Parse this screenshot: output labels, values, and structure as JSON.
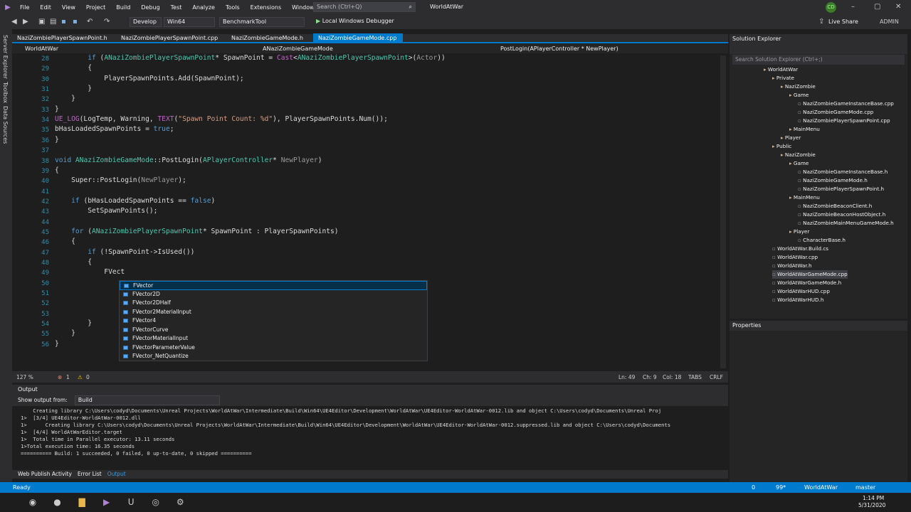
{
  "menu": [
    "File",
    "Edit",
    "View",
    "Project",
    "Build",
    "Debug",
    "Test",
    "Analyze",
    "Tools",
    "Extensions",
    "Window",
    "Help"
  ],
  "search_placeholder": "Search (Ctrl+Q)",
  "window_title": "WorldAtWar",
  "user_initials": "CD",
  "live_share": "Live Share",
  "admin": "ADMIN",
  "toolbar": {
    "config": "Develop",
    "platform": "Win64",
    "startup": "BenchmarkTool",
    "debugger": "Local Windows Debugger"
  },
  "side_tabs": [
    "Server Explorer",
    "Toolbox",
    "Data Sources"
  ],
  "tabs": [
    {
      "label": "NaziZombiePlayerSpawnPoint.h",
      "active": false
    },
    {
      "label": "NaziZombiePlayerSpawnPoint.cpp",
      "active": false
    },
    {
      "label": "NaziZombieGameMode.h",
      "active": false
    },
    {
      "label": "NaziZombieGameMode.cpp",
      "active": true
    }
  ],
  "nav": {
    "project": "WorldAtWar",
    "class": "ANaziZombieGameMode",
    "member": "PostLogin(APlayerController * NewPlayer)"
  },
  "line_numbers": [
    "28",
    "29",
    "30",
    "31",
    "32",
    "33",
    "34",
    "35",
    "36",
    "37",
    "38",
    "39",
    "40",
    "41",
    "42",
    "43",
    "44",
    "45",
    "46",
    "47",
    "48",
    "49",
    "50",
    "51",
    "52",
    "53",
    "54",
    "55",
    "56"
  ],
  "code_lines": [
    "        if (ANaziZombiePlayerSpawnPoint* SpawnPoint = Cast<ANaziZombiePlayerSpawnPoint>(Actor))",
    "        {",
    "            PlayerSpawnPoints.Add(SpawnPoint);",
    "        }",
    "    }",
    "}",
    "UE_LOG(LogTemp, Warning, TEXT(\"Spawn Point Count: %d\"), PlayerSpawnPoints.Num());",
    "bHasLoadedSpawnPoints = true;",
    "}",
    "",
    "void ANaziZombieGameMode::PostLogin(APlayerController* NewPlayer)",
    "{",
    "    Super::PostLogin(NewPlayer);",
    "",
    "    if (bHasLoadedSpawnPoints == false)",
    "        SetSpawnPoints();",
    "",
    "    for (ANaziZombiePlayerSpawnPoint* SpawnPoint : PlayerSpawnPoints)",
    "    {",
    "        if (!SpawnPoint->IsUsed())",
    "        {",
    "            FVect",
    "",
    "",
    "",
    "",
    "        }",
    "    }",
    "}"
  ],
  "autocomplete": [
    "FVector",
    "FVector2D",
    "FVector2DHalf",
    "FVector2MaterialInput",
    "FVector4",
    "FVectorCurve",
    "FVectorMaterialInput",
    "FVectorParameterValue",
    "FVector_NetQuantize"
  ],
  "editor_status": {
    "zoom": "127 %",
    "errors": "1",
    "warnings": "0",
    "ln": "Ln: 49",
    "ch": "Ch: 9",
    "col": "Col: 18",
    "tabs": "TABS",
    "crlf": "CRLF"
  },
  "output": {
    "title": "Output",
    "show_from_label": "Show output from:",
    "show_from_value": "Build",
    "lines": [
      "    Creating library C:\\Users\\codyd\\Documents\\Unreal Projects\\WorldAtWar\\Intermediate\\Build\\Win64\\UE4Editor\\Development\\WorldAtWar\\UE4Editor-WorldAtWar-0012.lib and object C:\\Users\\codyd\\Documents\\Unreal Proj",
      "1>  [3/4] UE4Editor-WorldAtWar-0012.dll",
      "1>      Creating library C:\\Users\\codyd\\Documents\\Unreal Projects\\WorldAtWar\\Intermediate\\Build\\Win64\\UE4Editor\\Development\\WorldAtWar\\UE4Editor-WorldAtWar-0012.suppressed.lib and object C:\\Users\\codyd\\Documents",
      "1>  [4/4] WorldAtWarEditor.target",
      "1>  Total time in Parallel executor: 13.11 seconds",
      "1>Total execution time: 16.35 seconds",
      "========== Build: 1 succeeded, 0 failed, 0 up-to-date, 0 skipped =========="
    ]
  },
  "bottom_tabs": [
    "Web Publish Activity",
    "Error List",
    "Output"
  ],
  "solution_explorer": {
    "title": "Solution Explorer",
    "search": "Search Solution Explorer (Ctrl+;)",
    "items": [
      {
        "label": "WorldAtWar",
        "depth": 0
      },
      {
        "label": "Private",
        "depth": 1
      },
      {
        "label": "NaziZombie",
        "depth": 2
      },
      {
        "label": "Game",
        "depth": 3
      },
      {
        "label": "NaziZombieGameInstanceBase.cpp",
        "depth": 4
      },
      {
        "label": "NaziZombieGameMode.cpp",
        "depth": 4
      },
      {
        "label": "NaziZombiePlayerSpawnPoint.cpp",
        "depth": 4
      },
      {
        "label": "MainMenu",
        "depth": 3
      },
      {
        "label": "Player",
        "depth": 2
      },
      {
        "label": "Public",
        "depth": 1
      },
      {
        "label": "NaziZombie",
        "depth": 2
      },
      {
        "label": "Game",
        "depth": 3
      },
      {
        "label": "NaziZombieGameInstanceBase.h",
        "depth": 4
      },
      {
        "label": "NaziZombieGameMode.h",
        "depth": 4
      },
      {
        "label": "NaziZombiePlayerSpawnPoint.h",
        "depth": 4
      },
      {
        "label": "MainMenu",
        "depth": 3
      },
      {
        "label": "NaziZombieBeaconClient.h",
        "depth": 4
      },
      {
        "label": "NaziZombieBeaconHostObject.h",
        "depth": 4
      },
      {
        "label": "NaziZombieMainMenuGameMode.h",
        "depth": 4
      },
      {
        "label": "Player",
        "depth": 3
      },
      {
        "label": "CharacterBase.h",
        "depth": 4
      },
      {
        "label": "WorldAtWar.Build.cs",
        "depth": 1
      },
      {
        "label": "WorldAtWar.cpp",
        "depth": 1
      },
      {
        "label": "WorldAtWar.h",
        "depth": 1
      },
      {
        "label": "WorldAtWarGameMode.cpp",
        "depth": 1
      },
      {
        "label": "WorldAtWarGameMode.h",
        "depth": 1
      },
      {
        "label": "WorldAtWarHUD.cpp",
        "depth": 1
      },
      {
        "label": "WorldAtWarHUD.h",
        "depth": 1
      }
    ]
  },
  "properties_title": "Properties",
  "status": {
    "ready": "Ready",
    "up": "0",
    "pen": "99*",
    "repo": "WorldAtWar",
    "branch": "master"
  },
  "clock": {
    "time": "1:14 PM",
    "date": "5/31/2020"
  }
}
